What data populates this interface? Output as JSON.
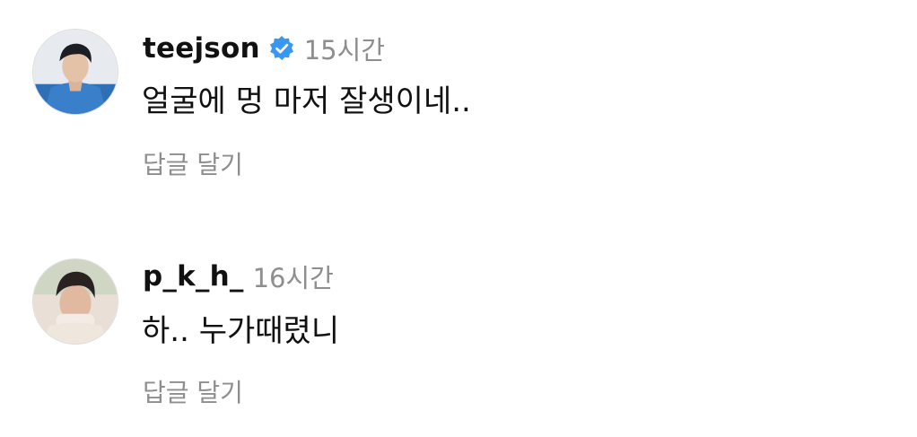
{
  "comments": [
    {
      "username": "teejson",
      "verified": true,
      "time": "15시간",
      "text": "얼굴에 멍 마저 잘생이네..",
      "reply_label": "답글 달기",
      "avatar_icon": "profile-photo"
    },
    {
      "username": "p_k_h_",
      "verified": false,
      "time": "16시간",
      "text": "하.. 누가때렸니",
      "reply_label": "답글 달기",
      "avatar_icon": "profile-photo"
    }
  ],
  "colors": {
    "text": "#111111",
    "secondary": "#8e8e8e",
    "verified_badge": "#3897f0",
    "background": "#ffffff"
  }
}
